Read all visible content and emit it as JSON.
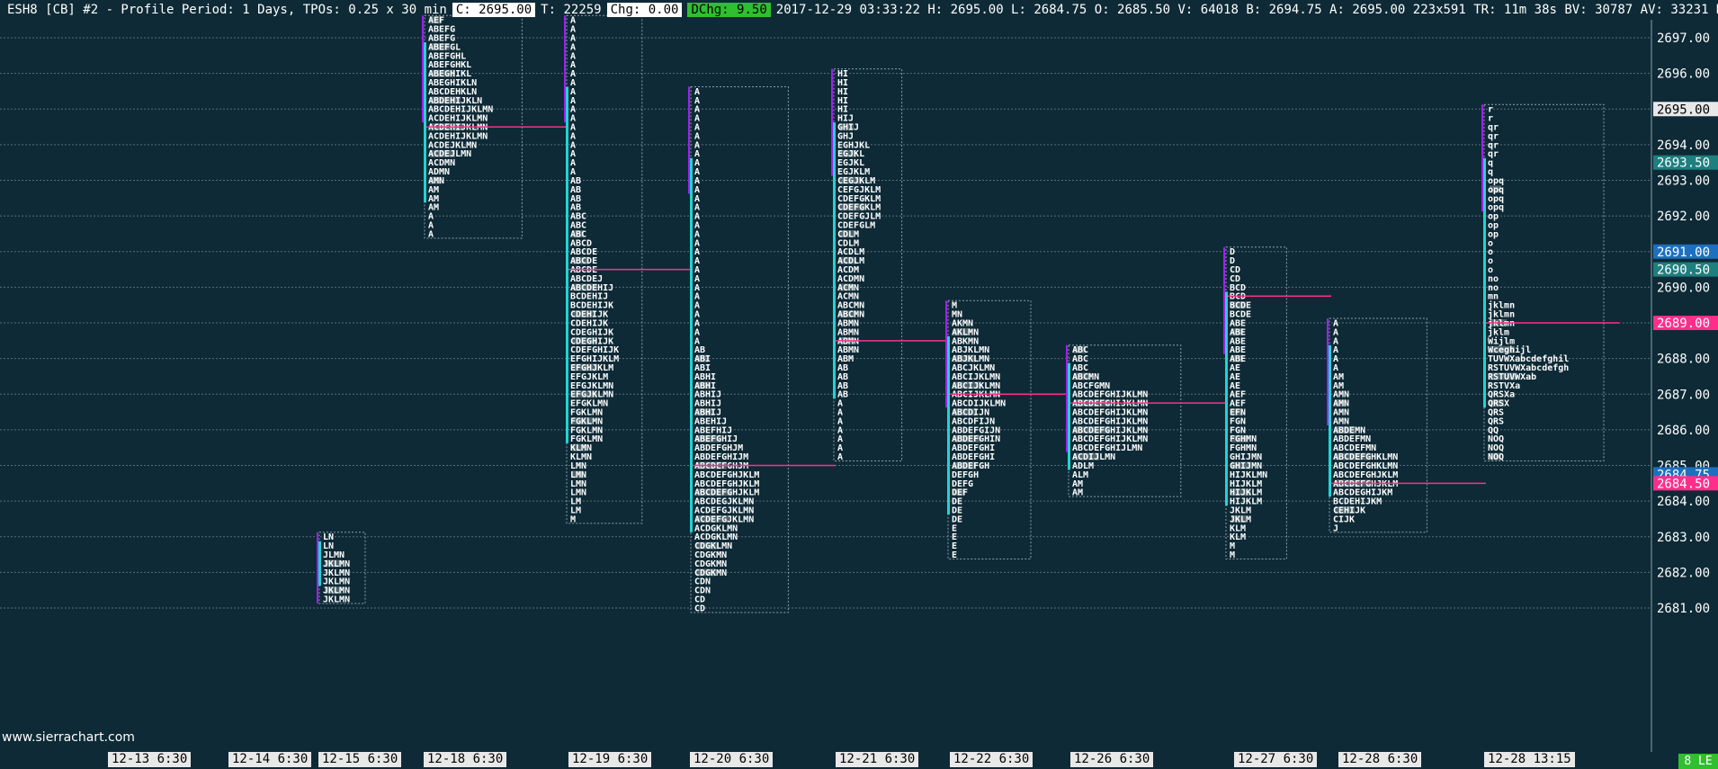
{
  "header": {
    "title": "ESH8 [CB]  #2 - Profile Period: 1 Days, TPOs: 0.25 x 30 min",
    "close": "C: 2695.00",
    "trades": "T: 22259",
    "chg": "Chg: 0.00",
    "dchg": "DChg: 9.50",
    "details": "2017-12-29 03:33:22 H: 2695.00 L: 2684.75 O: 2685.50 V: 64018 B: 2694.75 A: 2695.00 223x591 TR: 11m 38s BV: 30787 AV: 33231 DV: 59351"
  },
  "watermark": "www.sierrachart.com",
  "status_badge": "8 LE",
  "colors": {
    "background": "#0e2a36",
    "grid": "#5a6e78",
    "price_label_bg": "#e8e8e8",
    "poc_line": "#ff2e8a",
    "value_area_bar": "#22d3d3",
    "ib_bar": "#a020f0",
    "letter_blue": "#5ab0ff",
    "letter_red": "#ff2a2a",
    "volume_bar": "#7a8a90"
  },
  "x_axis_labels": [
    "12-13  6:30",
    "12-14  6:30",
    "12-15  6:30",
    "12-18  6:30",
    "12-19  6:30",
    "12-20  6:30",
    "12-21  6:30",
    "12-22  6:30",
    "12-26  6:30",
    "12-27  6:30",
    "12-28  6:30",
    "12-28  13:15"
  ],
  "price_axis": {
    "ticks": [
      "2697.00",
      "2696.00",
      "2695.00",
      "2694.00",
      "2693.00",
      "2692.00",
      "2691.00",
      "2690.00",
      "2689.00",
      "2688.00",
      "2687.00",
      "2686.00",
      "2685.00",
      "2684.00",
      "2683.00",
      "2682.00",
      "2681.00"
    ],
    "markers": [
      {
        "value": "2695.00",
        "color": "#e8e8e8",
        "text": "#000000"
      },
      {
        "value": "2693.50",
        "color": "#1e7f7f",
        "text": "#ffffff"
      },
      {
        "value": "2691.00",
        "color": "#1e6fbf",
        "text": "#ffffff"
      },
      {
        "value": "2690.50",
        "color": "#1e7f7f",
        "text": "#ffffff"
      },
      {
        "value": "2689.00",
        "color": "#ff2e8a",
        "text": "#ffffff"
      },
      {
        "value": "2684.75",
        "color": "#1e6fbf",
        "text": "#ffffff"
      },
      {
        "value": "2684.50",
        "color": "#ff2e8a",
        "text": "#ffffff"
      }
    ]
  },
  "profiles": [
    {
      "label": "12-15",
      "top": 2683.0,
      "rows": [
        "LN",
        "LN",
        "JLMN",
        "JKLMN",
        "JKLMN",
        "JKLMN",
        "JKLMN",
        "JKLMN"
      ]
    },
    {
      "label": "12-18",
      "top": 2697.5,
      "rows": [
        "AEF",
        "ABEFG",
        "ABEFG",
        "ABEFGL",
        "ABEFGHL",
        "ABEFGHKL",
        "ABEGHIKL",
        "ABEGHIKLN",
        "ABCDEHKLN",
        "ABDEHIJKLN",
        "ABCDEHIJKLMN",
        "ACDEHIJKLMN",
        "ACDEHIJKLMN",
        "ACDEHIJKLMN",
        "ACDEJKLMN",
        "ACDEJLMN",
        "ACDMN",
        "ADMN",
        "AMN",
        "AM",
        "AM",
        "AM",
        "A",
        "A",
        "A"
      ],
      "poc": 2694.5
    },
    {
      "label": "12-19",
      "top": 2697.5,
      "rows": [
        "A",
        "A",
        "A",
        "A",
        "A",
        "A",
        "A",
        "A",
        "A",
        "A",
        "A",
        "A",
        "A",
        "A",
        "A",
        "A",
        "A",
        "A",
        "AB",
        "AB",
        "AB",
        "AB",
        "ABC",
        "ABC",
        "ABC",
        "ABCD",
        "ABCDE",
        "ABCDE",
        "ABCDE",
        "ABCDEJ",
        "ABCDEHIJ",
        "BCDEHIJ",
        "BCDEHIJK",
        "CDEHIJK",
        "CDEHIJK",
        "CDEGHIJK",
        "CDEGHIJK",
        "CDEFGHIJK",
        "EFGHIJKLM",
        "EFGHJKLM",
        "EFGJKLM",
        "EFGJKLMN",
        "EFGJKLMN",
        "EFGKLMN",
        "FGKLMN",
        "FGKLMN",
        "FGKLMN",
        "FGKLMN",
        "KLMN",
        "KLMN",
        "LMN",
        "LMN",
        "LMN",
        "LMN",
        "LM",
        "LM",
        "M"
      ],
      "poc": 2690.5
    },
    {
      "label": "12-20",
      "top": 2695.5,
      "rows": [
        "A",
        "A",
        "A",
        "A",
        "A",
        "A",
        "A",
        "A",
        "A",
        "A",
        "A",
        "A",
        "A",
        "A",
        "A",
        "A",
        "A",
        "A",
        "A",
        "A",
        "A",
        "A",
        "A",
        "A",
        "A",
        "A",
        "A",
        "A",
        "A",
        "AB",
        "ABI",
        "ABI",
        "ABHI",
        "ABHI",
        "ABHIJ",
        "ABHIJ",
        "ABHIJ",
        "ABEHIJ",
        "ABEFHIJ",
        "ABEFGHIJ",
        "ABDEFGHJM",
        "ABDEFGHIJM",
        "ABCDEFGHJM",
        "ABCDEFGHJKLM",
        "ABCDEFGHJKLM",
        "ABCDEFGHJKLM",
        "ABCDEGJKLMN",
        "ACDEFGJKLMN",
        "ACDEFGJKLMN",
        "ACDGKLMN",
        "ACDGKLMN",
        "CDGKLMN",
        "CDGKMN",
        "CDGKMN",
        "CDGKMN",
        "CDN",
        "CDN",
        "CD",
        "CD"
      ],
      "poc": 2685.0
    },
    {
      "label": "12-21",
      "top": 2696.0,
      "rows": [
        "HI",
        "HI",
        "HI",
        "HI",
        "HI",
        "HIJ",
        "GHIJ",
        "GHJ",
        "EGHJKL",
        "EGJKL",
        "EGJKL",
        "EGJKLM",
        "CEGJKLM",
        "CEFGJKLM",
        "CDEFGKLM",
        "CDEFGKLM",
        "CDEFGJLM",
        "CDEFGLM",
        "CDLM",
        "CDLM",
        "ACDLM",
        "ACDLM",
        "ACDM",
        "ACDMN",
        "ACMN",
        "ACMN",
        "ABCMN",
        "ABCMN",
        "ABMN",
        "ABMN",
        "ABMN",
        "ABMN",
        "ABM",
        "AB",
        "AB",
        "AB",
        "AB",
        "A",
        "A",
        "A",
        "A",
        "A",
        "A",
        "A"
      ],
      "poc": 2688.5
    },
    {
      "label": "12-22",
      "top": 2689.5,
      "rows": [
        "M",
        "MN",
        "AKMN",
        "AKLMN",
        "ABKMN",
        "ABJKLMN",
        "ABJKLMN",
        "ABCJKLMN",
        "ABCIJKLMN",
        "ABCIJKLMN",
        "ABCIJKLMN",
        "ABCDIJKLMN",
        "ABCDIJN",
        "ABCDFIJN",
        "ABDEFGIJN",
        "ABDEFGHIN",
        "ABDEFGHI",
        "ABDEFGHI",
        "ABDEFGH",
        "DEFGH",
        "DEFG",
        "DEF",
        "DE",
        "DE",
        "DE",
        "E",
        "E",
        "E",
        "E"
      ],
      "poc": 2687.0
    },
    {
      "label": "12-26",
      "top": 2688.25,
      "rows": [
        "ABC",
        "ABC",
        "ABC",
        "ABCMN",
        "ABCFGMN",
        "ABCDEFGHIJKLMN",
        "ABCDEFGHIJKLMN",
        "ABCDEFGHIJKLMN",
        "ABCDEFGHIJKLMN",
        "ABCDEFGHIJKLMN",
        "ABCDEFGHIJKLMN",
        "ABCDEFGHIJLMN",
        "ACDIJLMN",
        "ADLM",
        "ALM",
        "AM",
        "AM"
      ],
      "poc": 2686.75
    },
    {
      "label": "12-27",
      "top": 2691.0,
      "rows": [
        "D",
        "D",
        "CD",
        "CD",
        "BCD",
        "BCD",
        "BCDE",
        "BCDE",
        "ABE",
        "ABE",
        "ABE",
        "ABE",
        "ABE",
        "AE",
        "AE",
        "AE",
        "AEF",
        "AEF",
        "EFN",
        "FGN",
        "FGN",
        "FGHMN",
        "FGHMN",
        "GHIJMN",
        "GHIJMN",
        "HIJKLMN",
        "HIJKLM",
        "HIJKLM",
        "HIJKLM",
        "JKLM",
        "JKLM",
        "KLM",
        "KLM",
        "M",
        "M"
      ],
      "poc": 2689.75
    },
    {
      "label": "12-28",
      "top": 2689.0,
      "rows": [
        "A",
        "A",
        "A",
        "A",
        "A",
        "A",
        "AM",
        "AM",
        "AMN",
        "AMN",
        "AMN",
        "AMN",
        "ABDEMN",
        "ABDEFMN",
        "ABCDEFMN",
        "ABCDEFGHKLMN",
        "ABCDEFGHKLMN",
        "ABCDEFGHJKLM",
        "ABCDEFGHJKLM",
        "ABCDEGHIJKM",
        "BCDEHIJKM",
        "CEHIJK",
        "CIJK",
        "J"
      ],
      "poc": 2684.5
    },
    {
      "label": "12-28 13:15",
      "top": 2695.0,
      "rows": [
        "r",
        "r",
        "qr",
        "qr",
        "qr",
        "qr",
        "q",
        "q",
        "opq",
        "opq",
        "opq",
        "opq",
        "op",
        "op",
        "op",
        "o",
        "o",
        "o",
        "o",
        "no",
        "no",
        "mn",
        "jklmn",
        "jklmn",
        "jklmn",
        "jklm",
        "Wijlm",
        "Wceghijl",
        "TUVWXabcdefghil",
        "RSTUVWXabcdefgh",
        "RSTUVWXab",
        "RSTVXa",
        "QRSXa",
        "QRSX",
        "QRS",
        "QRS",
        "QQ",
        "NOQ",
        "NOQ",
        "NOQ"
      ],
      "poc": 2689.0
    }
  ]
}
